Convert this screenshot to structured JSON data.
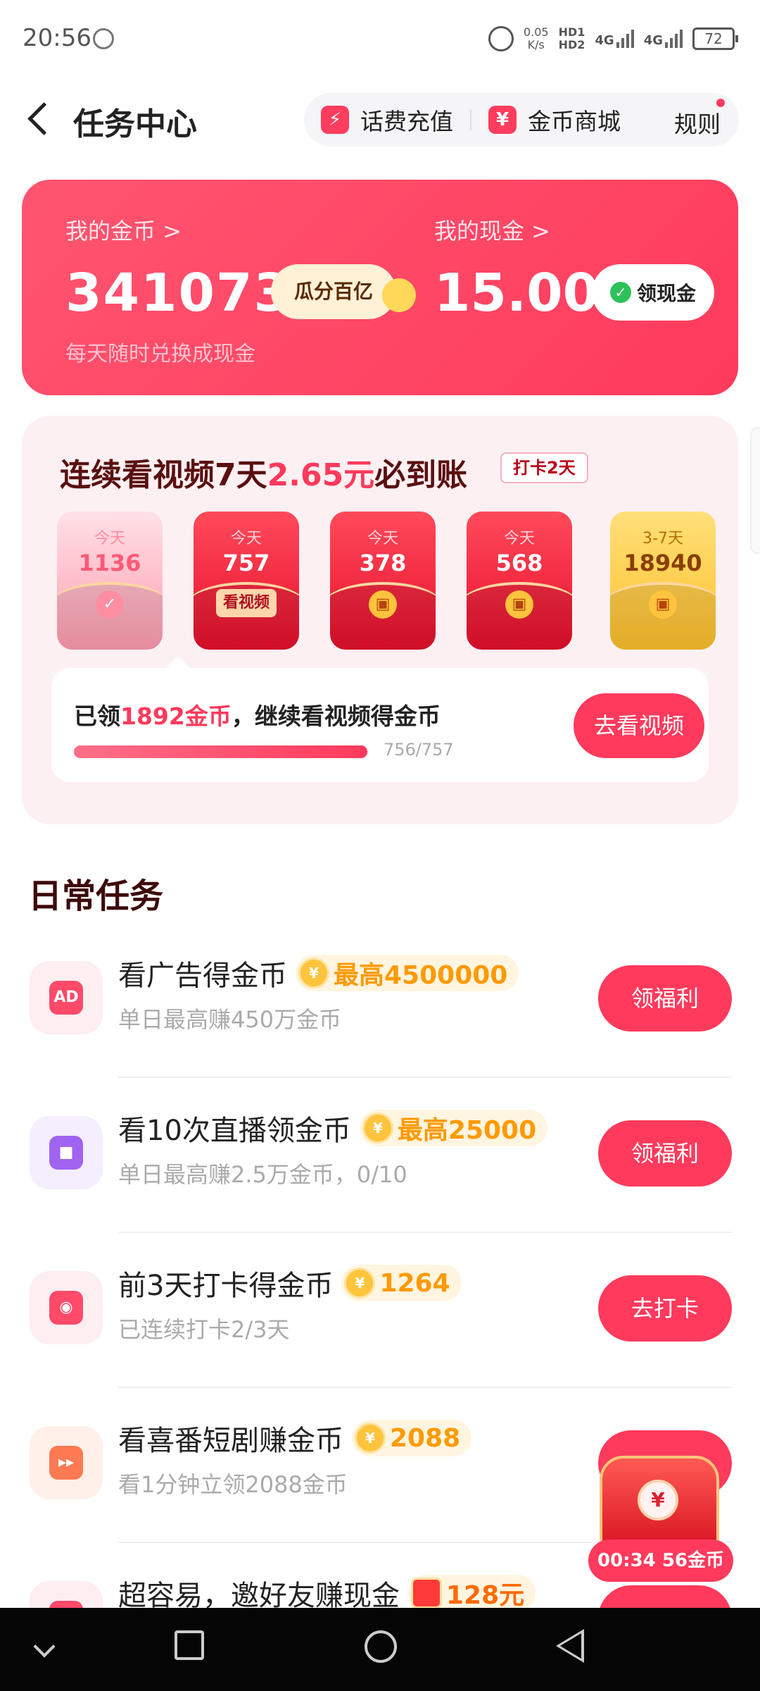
{
  "status": {
    "time": "20:56",
    "net_speed_value": "0.05",
    "net_speed_unit": "K/s",
    "hd1": "HD1",
    "hd2": "HD2",
    "net1": "4G",
    "net2": "4G",
    "battery": "72"
  },
  "header": {
    "title": "任务中心",
    "recharge": "话费充值",
    "mall": "金币商城",
    "rules": "规则"
  },
  "wallet": {
    "coins_label": "我的金币 >",
    "coins": "341073",
    "guafen": "瓜分百亿",
    "cash_label": "我的现金 >",
    "cash": "15.00",
    "cash_button": "领现金",
    "subtitle": "每天随时兑换成现金"
  },
  "streak": {
    "title_pre": "连续看视频7天",
    "title_amount": "2.65元",
    "title_post": "必到账",
    "badge": "打卡2天",
    "envelopes": [
      {
        "label": "今天",
        "value": "1136",
        "state": "done"
      },
      {
        "label": "今天",
        "value": "757",
        "state": "current",
        "action": "看视频"
      },
      {
        "label": "今天",
        "value": "378",
        "state": "locked"
      },
      {
        "label": "今天",
        "value": "568",
        "state": "locked"
      },
      {
        "label": "3-7天",
        "value": "18940",
        "state": "gold"
      }
    ],
    "progress_pre": "已领",
    "progress_amount": "1892金币",
    "progress_post": "，继续看视频得金币",
    "progress_count": "756/757",
    "progress_fraction": 0.9987,
    "button": "去看视频"
  },
  "daily": {
    "title": "日常任务",
    "tasks": [
      {
        "icon": "ad-icon",
        "icon_text": "AD",
        "name": "看广告得金币",
        "reward": "最高4500000",
        "sub": "单日最高赚450万金币",
        "button": "领福利"
      },
      {
        "icon": "live-video-icon",
        "icon_text": "",
        "name": "看10次直播领金币",
        "reward": "最高25000",
        "sub": "单日最高赚2.5万金币，0/10",
        "button": "领福利"
      },
      {
        "icon": "checkin-icon",
        "icon_text": "",
        "name": "前3天打卡得金币",
        "reward": "1264",
        "sub": "已连续打卡2/3天",
        "button": "去打卡"
      },
      {
        "icon": "drama-icon",
        "icon_text": "",
        "name": "看喜番短剧赚金币",
        "reward": "2088",
        "sub": "看1分钟立领2088金币",
        "button": ""
      },
      {
        "icon": "invite-icon",
        "icon_text": "",
        "name": "超容易，邀好友赚现金",
        "reward": "128元",
        "sub": "",
        "button": ""
      }
    ]
  },
  "floating": {
    "timer": "00:34",
    "coins": "56金币"
  },
  "colors": {
    "accent": "#ff3a5c",
    "gold": "#ff9a00"
  }
}
